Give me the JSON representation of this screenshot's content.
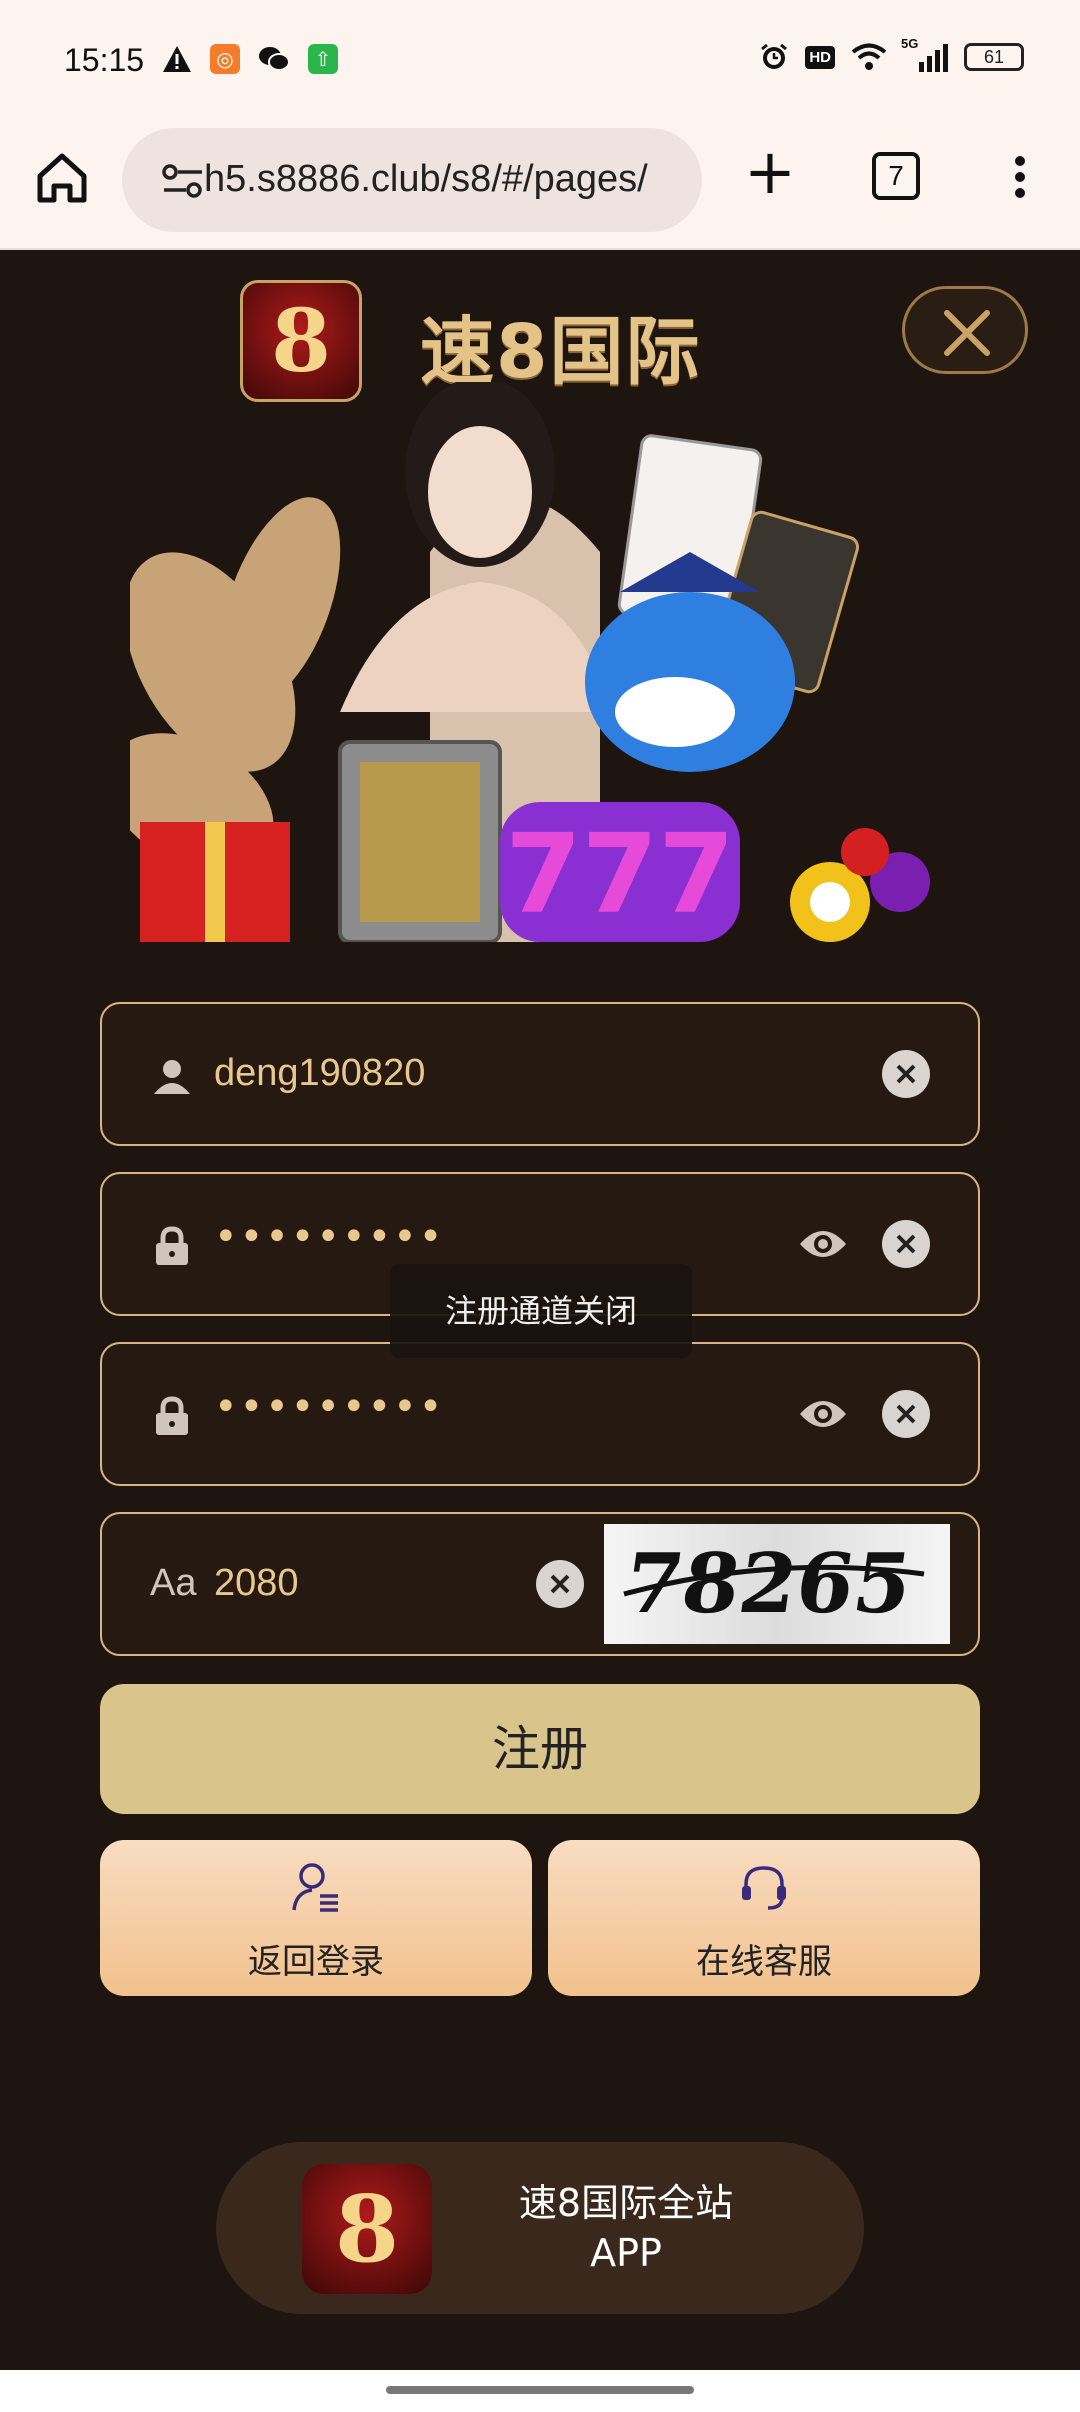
{
  "status_bar": {
    "time": "15:15",
    "network": "5G",
    "hd_badge": "HD",
    "battery": "61",
    "left_icons": [
      "warning-icon",
      "app-icon",
      "wechat-icon",
      "upload-icon"
    ],
    "right_icons": [
      "alarm-icon",
      "hd-icon",
      "wifi-icon",
      "signal-icon",
      "battery-icon"
    ]
  },
  "browser": {
    "url": "h5.s8886.club/s8/#/pages/",
    "tab_count": "7"
  },
  "header": {
    "logo_text": "8",
    "brand_title": "速8国际"
  },
  "form": {
    "username": "deng190820",
    "password_mask": "•••••••••",
    "confirm_mask": "•••••••••",
    "captcha_prefix": "Aa",
    "captcha_value": "2080",
    "captcha_image_text": "78265"
  },
  "toast": "注册通道关闭",
  "buttons": {
    "register": "注册",
    "back_login": "返回登录",
    "support": "在线客服"
  },
  "app_promo": {
    "icon_text": "8",
    "line1": "速8国际全站",
    "line2": "APP"
  },
  "colors": {
    "background": "#1e1410",
    "field_border": "#d8b583",
    "register_button": "#d9c58c",
    "secondary_button": "#f2c18d"
  }
}
